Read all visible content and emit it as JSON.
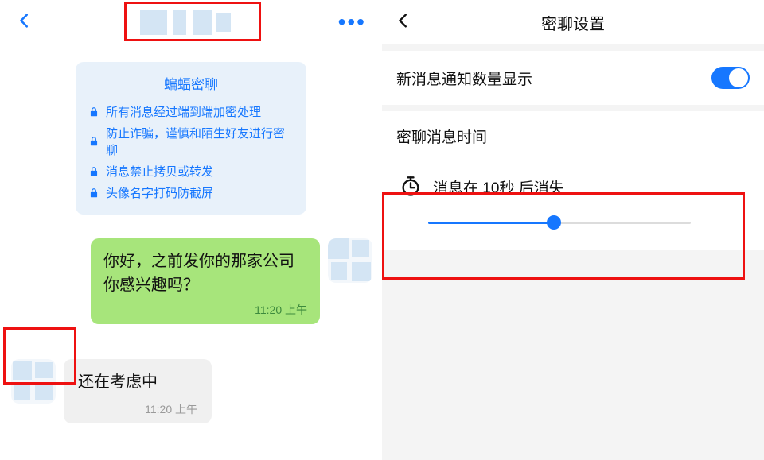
{
  "left": {
    "info_title": "蝙蝠密聊",
    "info_items": [
      "所有消息经过端到端加密处理",
      "防止诈骗，谨慎和陌生好友进行密聊",
      "消息禁止拷贝或转发",
      "头像名字打码防截屏"
    ],
    "msg_out_text": "你好，之前发你的那家公司你感兴趣吗？",
    "msg_out_time": "11:20  上午",
    "msg_in_text": "还在考虑中",
    "msg_in_time": "11:20  上午"
  },
  "right": {
    "title": "密聊设置",
    "notify_label": "新消息通知数量显示",
    "notify_on": true,
    "time_section_label": "密聊消息时间",
    "expire_text": "消息在 10秒 后消失",
    "slider_percent": 48
  },
  "colors": {
    "accent": "#1677ff",
    "red": "#e11"
  }
}
